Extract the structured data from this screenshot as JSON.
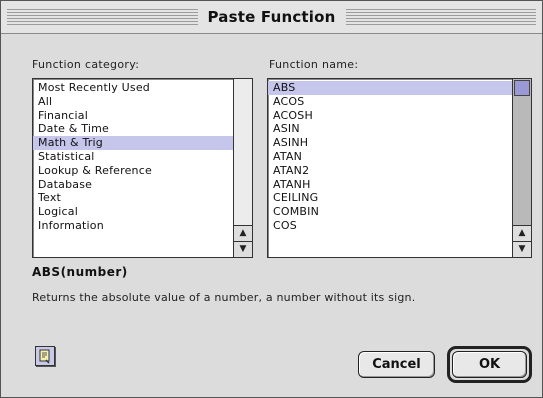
{
  "window": {
    "title": "Paste Function"
  },
  "category": {
    "label": "Function category:",
    "items": [
      "Most Recently Used",
      "All",
      "Financial",
      "Date & Time",
      "Math & Trig",
      "Statistical",
      "Lookup & Reference",
      "Database",
      "Text",
      "Logical",
      "Information"
    ],
    "selected": "Math & Trig"
  },
  "function_name": {
    "label": "Function name:",
    "items": [
      "ABS",
      "ACOS",
      "ACOSH",
      "ASIN",
      "ASINH",
      "ATAN",
      "ATAN2",
      "ATANH",
      "CEILING",
      "COMBIN",
      "COS"
    ],
    "selected": "ABS"
  },
  "syntax": "ABS(number)",
  "description": "Returns the absolute value of a number, a number without its sign.",
  "buttons": {
    "cancel": "Cancel",
    "ok": "OK"
  },
  "icons": {
    "help": "help-assistant-icon",
    "scroll_up": "arrow-up-icon",
    "scroll_down": "arrow-down-icon"
  },
  "colors": {
    "selection": "#c6c6ec",
    "thumb": "#9a99d6"
  }
}
